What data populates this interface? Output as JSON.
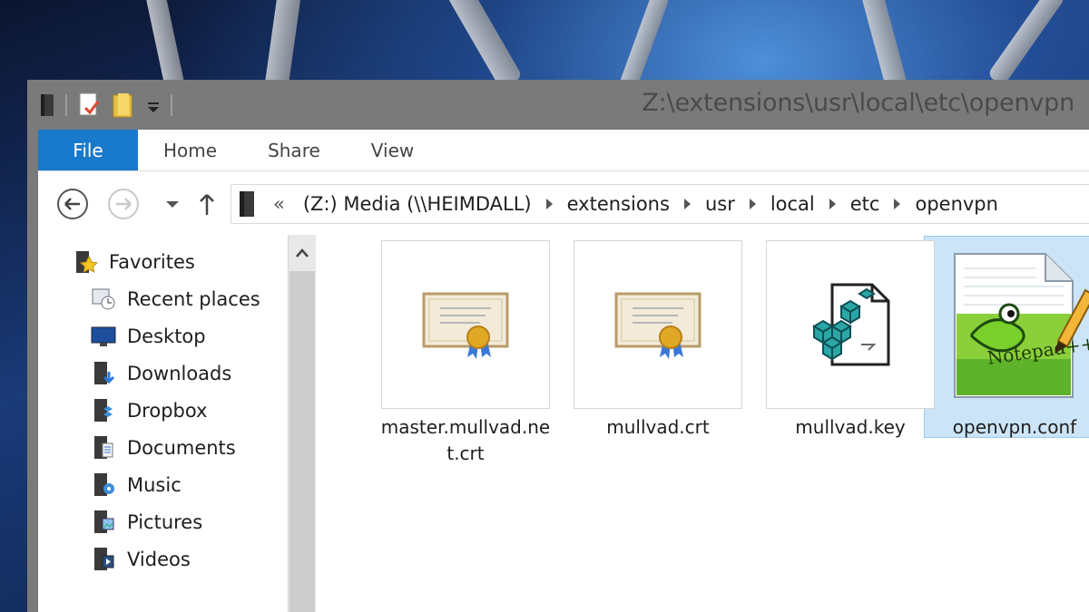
{
  "window": {
    "title": "Z:\\extensions\\usr\\local\\etc\\openvpn"
  },
  "ribbon": {
    "tabs": [
      "File",
      "Home",
      "Share",
      "View"
    ]
  },
  "address": {
    "overflow": "«",
    "crumbs": [
      "(Z:) Media (\\\\HEIMDALL)",
      "extensions",
      "usr",
      "local",
      "etc",
      "openvpn"
    ]
  },
  "sidebar": {
    "favorites": "Favorites",
    "items": [
      "Recent places",
      "Desktop",
      "Downloads",
      "Dropbox",
      "Documents",
      "Music",
      "Pictures",
      "Videos"
    ]
  },
  "files": [
    {
      "name": "master.mullvad.net.crt",
      "type": "certificate"
    },
    {
      "name": "mullvad.crt",
      "type": "certificate"
    },
    {
      "name": "mullvad.key",
      "type": "registry"
    },
    {
      "name": "openvpn.conf",
      "type": "notepad",
      "selected": true
    }
  ],
  "colors": {
    "file_tab": "#1979ca",
    "selection": "#cce4f7",
    "window_frame": "#7a7a7a"
  }
}
